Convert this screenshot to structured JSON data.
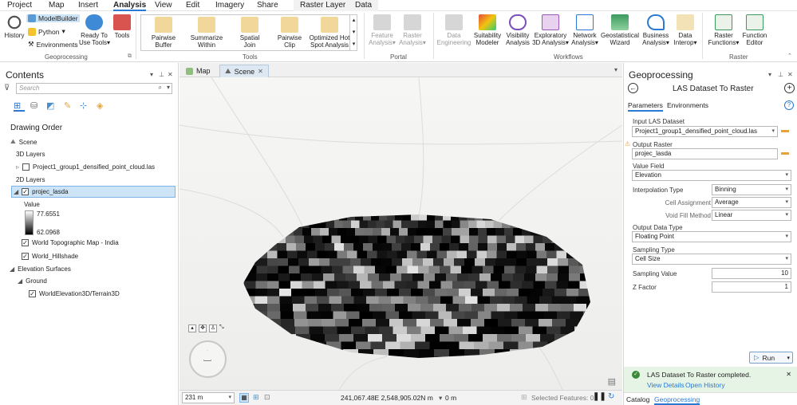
{
  "menu": {
    "items": [
      "Project",
      "Map",
      "Insert",
      "Analysis",
      "View",
      "Edit",
      "Imagery",
      "Share"
    ],
    "active": "Analysis",
    "contextual_tabs": [
      "Raster Layer",
      "Data"
    ]
  },
  "ribbon": {
    "geoprocessing": {
      "history": "History",
      "modelbuilder": "ModelBuilder",
      "python": "Python",
      "environments": "Environments",
      "ready_line1": "Ready To",
      "ready_line2": "Use Tools",
      "tools": "Tools",
      "label": "Geoprocessing"
    },
    "tools_gallery": [
      {
        "line1": "Pairwise",
        "line2": "Buffer"
      },
      {
        "line1": "Summarize",
        "line2": "Within"
      },
      {
        "line1": "Spatial",
        "line2": "Join"
      },
      {
        "line1": "Pairwise",
        "line2": "Clip"
      },
      {
        "line1": "Optimized Hot",
        "line2": "Spot Analysis"
      }
    ],
    "tools_label": "Tools",
    "portal": [
      {
        "line1": "Feature",
        "line2": "Analysis"
      },
      {
        "line1": "Raster",
        "line2": "Analysis"
      }
    ],
    "portal_label": "Portal",
    "workflows": [
      {
        "line1": "Data",
        "line2": "Engineering"
      },
      {
        "line1": "Suitability",
        "line2": "Modeler"
      },
      {
        "line1": "Visibility",
        "line2": "Analysis"
      },
      {
        "line1": "Exploratory",
        "line2": "3D Analysis"
      },
      {
        "line1": "Network",
        "line2": "Analysis"
      },
      {
        "line1": "Geostatistical",
        "line2": "Wizard"
      },
      {
        "line1": "Business",
        "line2": "Analysis"
      },
      {
        "line1": "Data",
        "line2": "Interop"
      }
    ],
    "workflows_label": "Workflows",
    "raster": [
      {
        "line1": "Raster",
        "line2": "Functions"
      },
      {
        "line1": "Function",
        "line2": "Editor"
      }
    ],
    "raster_label": "Raster"
  },
  "contents": {
    "title": "Contents",
    "search_placeholder": "Search",
    "drawing_order": "Drawing Order",
    "scene": "Scene",
    "layers_3d": "3D Layers",
    "point_cloud": "Project1_group1_densified_point_cloud.las",
    "layers_2d": "2D Layers",
    "projec_lasda": "projec_lasda",
    "value_label": "Value",
    "value_max": "77.6551",
    "value_min": "62.0968",
    "topo": "World Topographic Map - India",
    "hillshade": "World_Hillshade",
    "elevation_surfaces": "Elevation Surfaces",
    "ground": "Ground",
    "terrain": "WorldElevation3D/Terrain3D"
  },
  "view": {
    "tab_map": "Map",
    "tab_scene": "Scene",
    "scale": "231 m",
    "coords": "241,067.48E 2,548,905.02N m",
    "elevation": "0 m",
    "selected_features": "Selected Features: 0"
  },
  "geoprocessing": {
    "title": "Geoprocessing",
    "tool_name": "LAS Dataset To Raster",
    "tab_parameters": "Parameters",
    "tab_environments": "Environments",
    "input_las_label": "Input LAS Dataset",
    "input_las_value": "Project1_group1_densified_point_cloud.las",
    "output_raster_label": "Output Raster",
    "output_raster_value": "projec_lasda",
    "value_field_label": "Value Field",
    "value_field_value": "Elevation",
    "interp_label": "Interpolation Type",
    "interp_value": "Binning",
    "cell_assign_label": "Cell Assignment",
    "cell_assign_value": "Average",
    "void_fill_label": "Void Fill Method",
    "void_fill_value": "Linear",
    "output_dtype_label": "Output Data Type",
    "output_dtype_value": "Floating Point",
    "sampling_type_label": "Sampling Type",
    "sampling_type_value": "Cell Size",
    "sampling_value_label": "Sampling Value",
    "sampling_value_value": "10",
    "z_factor_label": "Z Factor",
    "z_factor_value": "1",
    "run": "Run",
    "completed": "LAS Dataset To Raster completed.",
    "view_details": "View Details",
    "open_history": "Open History",
    "tab_catalog": "Catalog",
    "tab_geoprocessing": "Geoprocessing"
  },
  "colors": {
    "accent": "#2b79d2",
    "success_bg": "#e6f4e6",
    "selection": "#cde4f7"
  }
}
